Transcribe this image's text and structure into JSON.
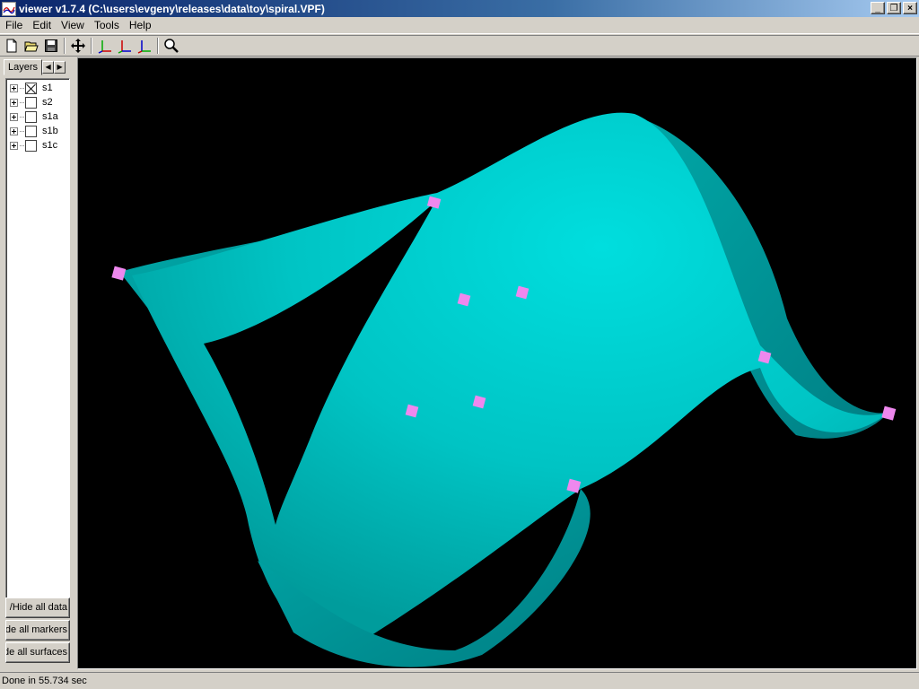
{
  "window": {
    "title": "viewer v1.7.4 (C:\\users\\evgeny\\releases\\data\\toy\\spiral.VPF)",
    "minimize_glyph": "_",
    "restore_glyph": "❐",
    "close_glyph": "×"
  },
  "menu": {
    "items": [
      {
        "label": "File"
      },
      {
        "label": "Edit"
      },
      {
        "label": "View"
      },
      {
        "label": "Tools"
      },
      {
        "label": "Help"
      }
    ]
  },
  "toolbar": {
    "buttons": [
      {
        "icon": "new-file-icon"
      },
      {
        "icon": "open-folder-icon"
      },
      {
        "icon": "save-disk-icon"
      },
      {
        "icon": "move-arrows-icon"
      },
      {
        "icon": "axes-xy-icon"
      },
      {
        "icon": "axes-xz-icon"
      },
      {
        "icon": "axes-yz-icon"
      },
      {
        "icon": "zoom-icon"
      }
    ]
  },
  "left_panel": {
    "tab_label": "Layers",
    "layers": [
      {
        "label": "s1",
        "checked": true
      },
      {
        "label": "s2",
        "checked": false
      },
      {
        "label": "s1a",
        "checked": false
      },
      {
        "label": "s1b",
        "checked": false
      },
      {
        "label": "s1c",
        "checked": false
      }
    ],
    "buttons": [
      {
        "label": "/Hide all data"
      },
      {
        "label": "w/Hide all markers"
      },
      {
        "label": "w/Hide all surfaces"
      }
    ]
  },
  "viewport": {
    "background": "#000000",
    "surface_color": "#00c8c8",
    "marker_color": "#ee88ee"
  },
  "status": {
    "text": "Done in 55.734 sec"
  }
}
